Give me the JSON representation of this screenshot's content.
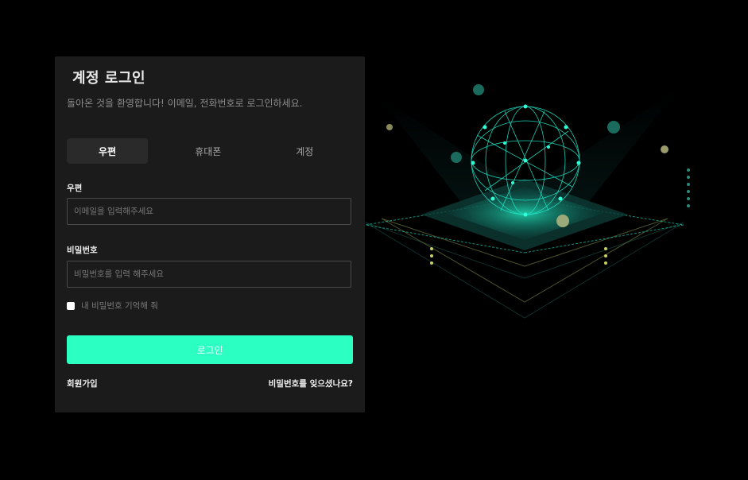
{
  "login": {
    "title": "계정 로그인",
    "subtitle": "돌아온 것을 환영합니다! 이메일, 전화번호로 로그인하세요.",
    "tabs": [
      {
        "label": "우편",
        "active": true
      },
      {
        "label": "휴대폰",
        "active": false
      },
      {
        "label": "계정",
        "active": false
      }
    ],
    "email_label": "우편",
    "email_placeholder": "이메일을 입력해주세요",
    "password_label": "비밀번호",
    "password_placeholder": "비밀번호를 입력 해주세요",
    "remember_label": "내 비밀번호 기억해 줘",
    "login_button": "로그인",
    "signup_link": "회원가입",
    "forgot_link": "비밀번호를 잊으셨나요?"
  },
  "colors": {
    "background": "#000000",
    "panel": "#1b1b1b",
    "accent": "#2bffc1"
  }
}
